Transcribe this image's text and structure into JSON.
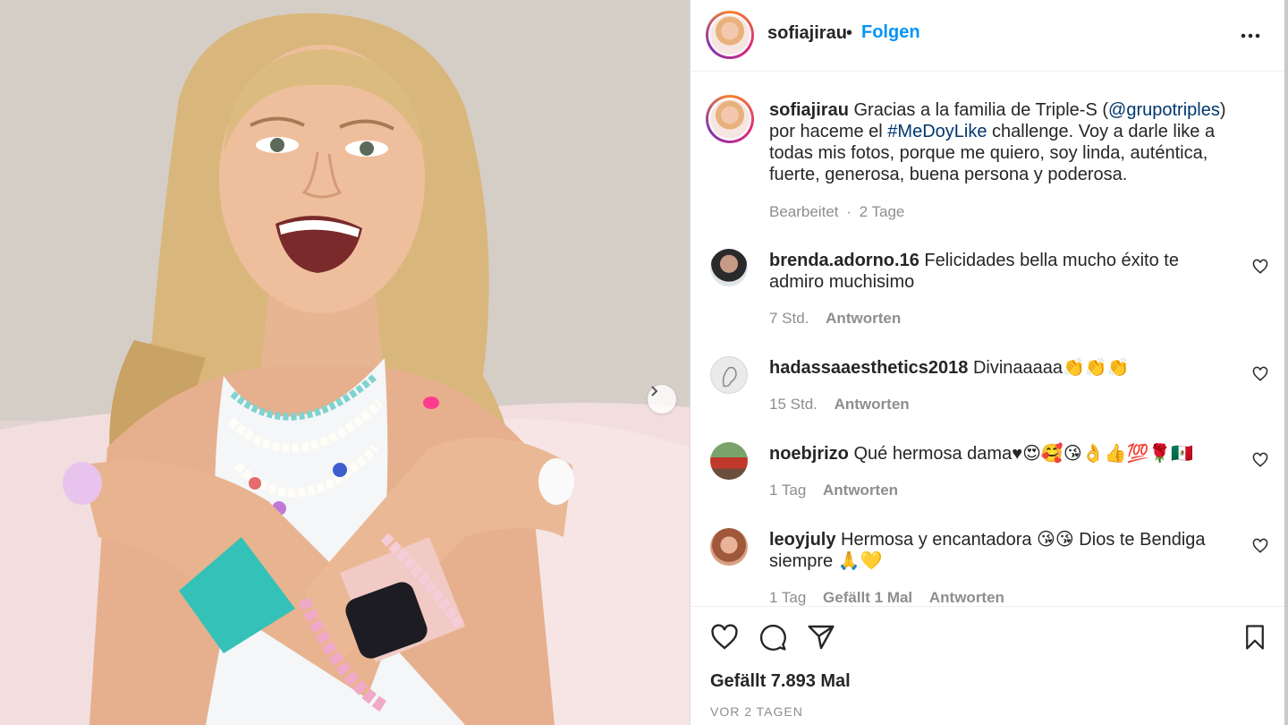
{
  "post": {
    "username": "sofiajirau",
    "separator": "•",
    "follow_label": "Folgen",
    "more_icon": "more-horizontal-icon"
  },
  "caption": {
    "username": "sofiajirau",
    "text_1": "Gracias a la familia de Triple-S (",
    "mention": "@grupotriples",
    "text_2": ") por haceme el ",
    "hashtag": "#MeDoyLike",
    "text_3": " challenge. Voy a darle like a todas mis fotos, porque me quiero, soy linda, auténtica, fuerte, generosa, buena persona y poderosa.",
    "edited": "Bearbeitet",
    "dot": "·",
    "age": "2 Tage"
  },
  "comments": [
    {
      "username": "brenda.adorno.16",
      "text": "Felicidades bella mucho éxito te admiro muchisimo",
      "age": "7 Std.",
      "likes": "",
      "reply": "Antworten"
    },
    {
      "username": "hadassaaesthetics2018",
      "text": "Divinaaaaa👏👏👏",
      "age": "15 Std.",
      "likes": "",
      "reply": "Antworten"
    },
    {
      "username": "noebjrizo",
      "text": "Qué hermosa dama♥😍🥰😘👌👍💯🌹🇲🇽",
      "age": "1 Tag",
      "likes": "",
      "reply": "Antworten"
    },
    {
      "username": "leoyjuly",
      "text": "Hermosa y encantadora 😘😘 Dios te Bendiga siempre 🙏💛",
      "age": "1 Tag",
      "likes": "Gefällt 1 Mal",
      "reply": "Antworten"
    }
  ],
  "footer": {
    "likes_label": "Gefällt 7.893 Mal",
    "time_label": "VOR 2 TAGEN"
  },
  "colors": {
    "link_blue": "#0095f6",
    "mention_blue": "#00376b",
    "secondary_text": "#8e8e8e"
  }
}
